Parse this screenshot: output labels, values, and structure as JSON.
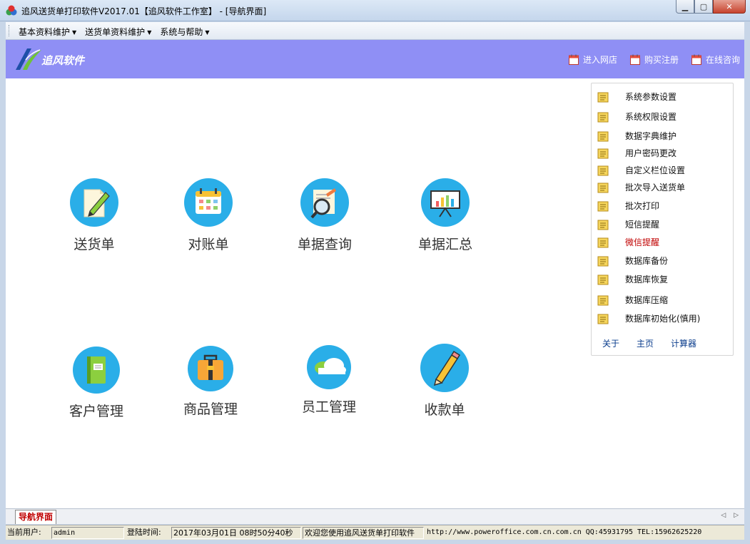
{
  "window": {
    "title": "追风送货单打印软件V2017.01【追风软件工作室】 - [导航界面]",
    "minimize": "▁",
    "maximize": "▢",
    "close": "✕"
  },
  "menubar": {
    "items": [
      {
        "label": "基本资料维护",
        "caret": "▼"
      },
      {
        "label": "送货单资料维护",
        "caret": "▼"
      },
      {
        "label": "系统与帮助",
        "caret": "▼"
      }
    ]
  },
  "banner": {
    "logo_text": "追风软件",
    "links": [
      {
        "label": "进入网店",
        "icon": "calendar-icon"
      },
      {
        "label": "购买注册",
        "icon": "calendar-icon"
      },
      {
        "label": "在线咨询",
        "icon": "calendar-icon"
      }
    ]
  },
  "tiles": [
    {
      "label": "送货单",
      "icon": "edit-document-icon"
    },
    {
      "label": "对账单",
      "icon": "calendar-icon"
    },
    {
      "label": "单据查询",
      "icon": "magnifier-document-icon"
    },
    {
      "label": "单据汇总",
      "icon": "presentation-chart-icon"
    },
    {
      "label": "客户管理",
      "icon": "notebook-icon"
    },
    {
      "label": "商品管理",
      "icon": "briefcase-icon"
    },
    {
      "label": "员工管理",
      "icon": "cloud-icon"
    },
    {
      "label": "收款单",
      "icon": "pencil-icon"
    }
  ],
  "sidepanel": {
    "items": [
      {
        "label": "系统参数设置"
      },
      {
        "label": "系统权限设置"
      },
      {
        "label": "数据字典维护"
      },
      {
        "label": "用户密码更改"
      },
      {
        "label": "自定义栏位设置"
      },
      {
        "label": "批次导入送货单"
      },
      {
        "label": "批次打印"
      },
      {
        "label": "短信提醒"
      },
      {
        "label": "微信提醒"
      },
      {
        "label": "数据库备份"
      },
      {
        "label": "数据库恢复"
      },
      {
        "label": "数据库压缩"
      },
      {
        "label": "数据库初始化(慎用)"
      }
    ],
    "links": [
      {
        "label": "关于"
      },
      {
        "label": "主页"
      },
      {
        "label": "计算器"
      }
    ],
    "highlight_color": "#c00000"
  },
  "tabs": {
    "active": "导航界面",
    "arrows": "◁ ▷"
  },
  "status": {
    "user_label": "当前用户:",
    "user_value": "admin",
    "login_label": "登陆时间:",
    "login_value": "2017年03月01日 08时50分40秒",
    "welcome": "欢迎您使用追风送货单打印软件",
    "info": "http://www.poweroffice.com.cn.com.cn QQ:45931795 TEL:15962625220"
  },
  "colors": {
    "banner": "#8f8ff5",
    "tile_circle": "#2aaee8",
    "tab_text": "#c00000"
  }
}
